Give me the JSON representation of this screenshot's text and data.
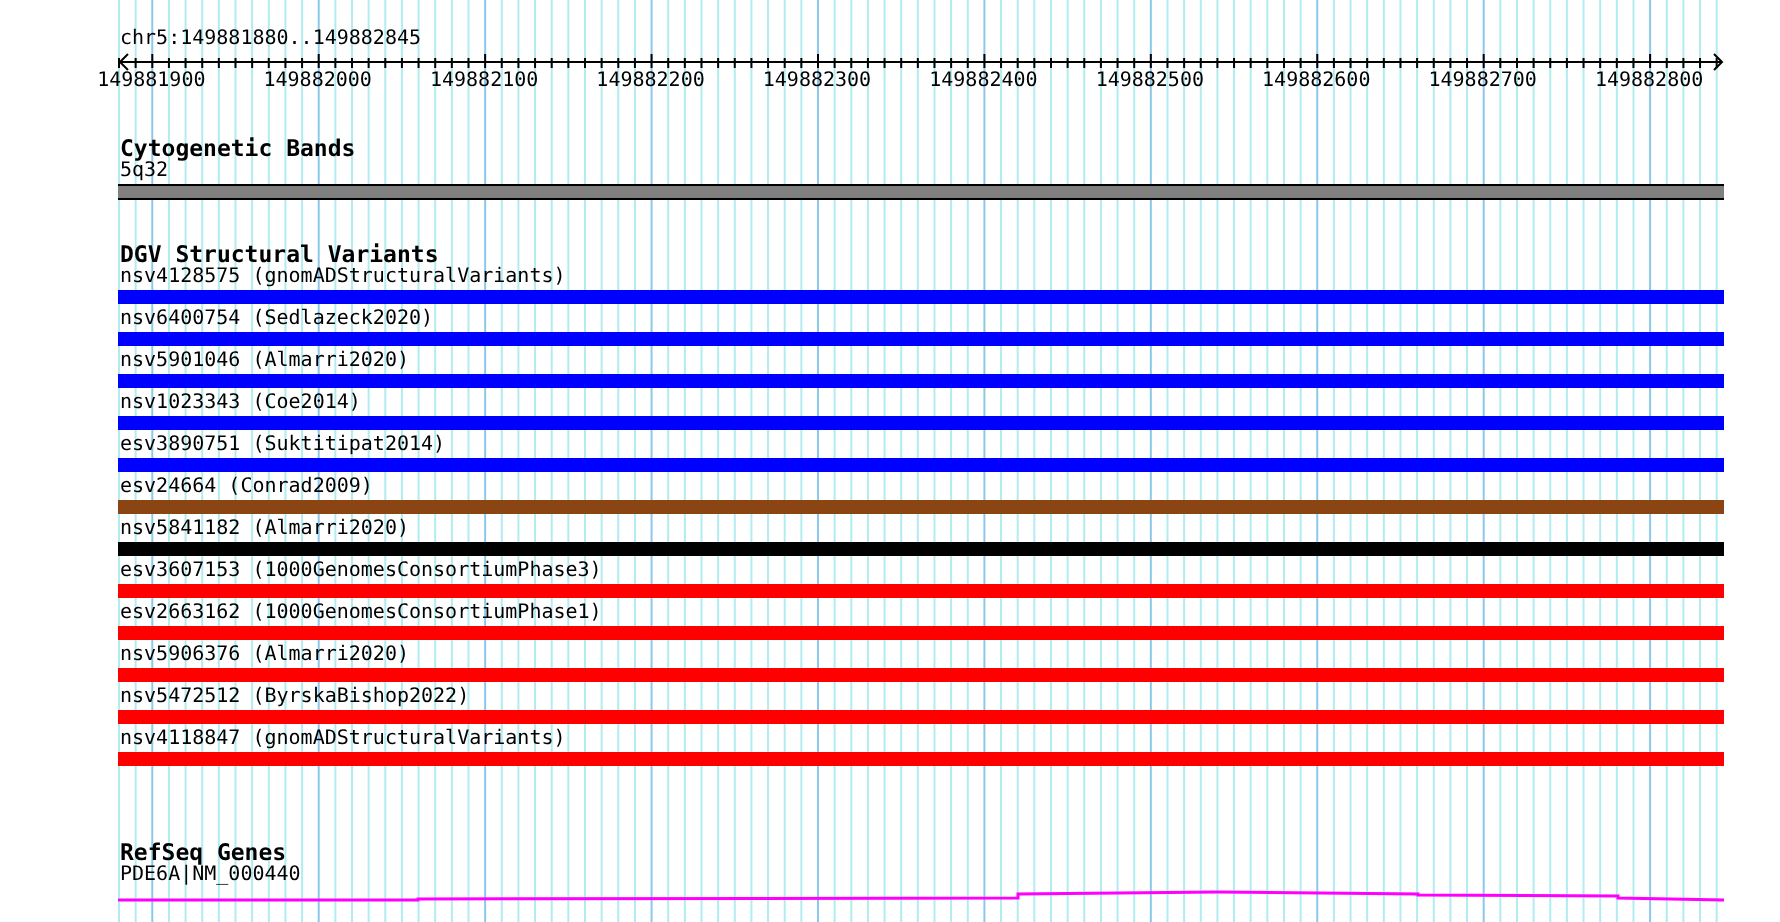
{
  "ruler": {
    "range": "chr5:149881880..149882845",
    "tick_labels": [
      "149881900",
      "149882000",
      "149882100",
      "149882200",
      "149882300",
      "149882400",
      "149882500",
      "149882600",
      "149882700",
      "149882800"
    ]
  },
  "cytogenetic_bands": {
    "title": "Cytogenetic Bands",
    "band": "5q32"
  },
  "structural_variants": {
    "title": "DGV Structural Variants",
    "items": [
      {
        "label": "nsv4128575 (gnomADStructuralVariants)",
        "color": "#0000ff"
      },
      {
        "label": "nsv6400754 (Sedlazeck2020)",
        "color": "#0000ff"
      },
      {
        "label": "nsv5901046 (Almarri2020)",
        "color": "#0000ff"
      },
      {
        "label": "nsv1023343 (Coe2014)",
        "color": "#0000ff"
      },
      {
        "label": "esv3890751 (Suktitipat2014)",
        "color": "#0000ff"
      },
      {
        "label": "esv24664 (Conrad2009)",
        "color": "#8b4513"
      },
      {
        "label": "nsv5841182 (Almarri2020)",
        "color": "#000000"
      },
      {
        "label": "esv3607153 (1000GenomesConsortiumPhase3)",
        "color": "#ff0000"
      },
      {
        "label": "esv2663162 (1000GenomesConsortiumPhase1)",
        "color": "#ff0000"
      },
      {
        "label": "nsv5906376 (Almarri2020)",
        "color": "#ff0000"
      },
      {
        "label": "nsv5472512 (ByrskaBishop2022)",
        "color": "#ff0000"
      },
      {
        "label": "nsv4118847 (gnomADStructuralVariants)",
        "color": "#ff0000"
      }
    ]
  },
  "refseq_genes": {
    "title": "RefSeq Genes",
    "gene": "PDE6A|NM_000440"
  }
}
